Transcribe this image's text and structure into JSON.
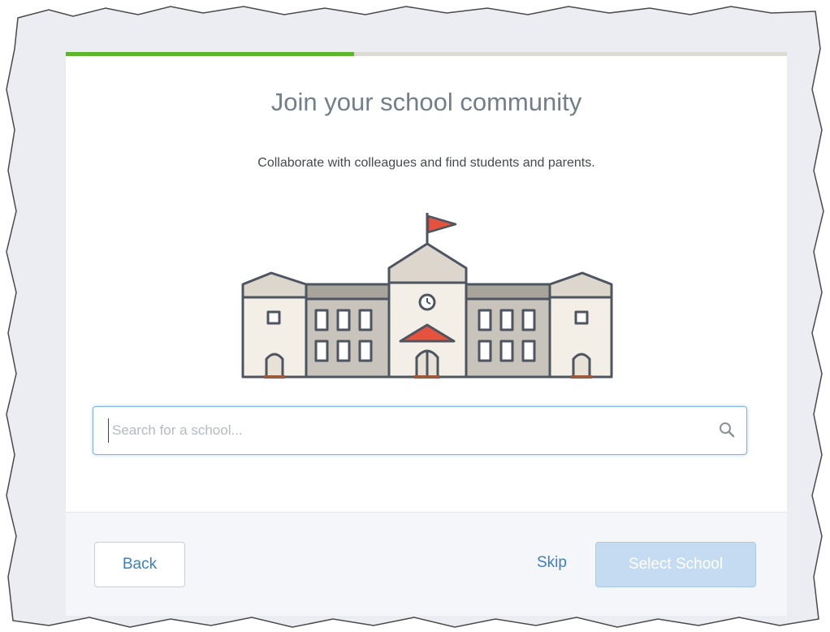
{
  "onboarding": {
    "progress": 0.4,
    "title": "Join your school community",
    "subtitle": "Collaborate with colleagues and find students and parents.",
    "illustration": "school-building-icon"
  },
  "search": {
    "placeholder": "Search for a school...",
    "value": "",
    "icon": "search-icon"
  },
  "footer": {
    "back_label": "Back",
    "skip_label": "Skip",
    "select_label": "Select School"
  },
  "colors": {
    "progress": "#5db629",
    "accent": "#3a7fc8",
    "select_disabled": "#c4dbf2",
    "flag": "#e5533f"
  }
}
